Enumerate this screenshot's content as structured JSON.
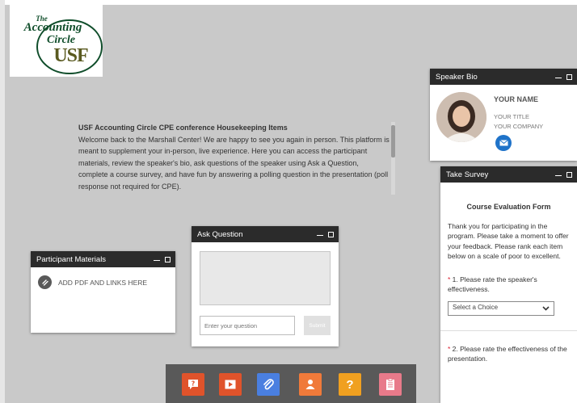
{
  "logo": {
    "line1": "The",
    "line2": "Accounting",
    "line3": "Circle",
    "line4": "USF"
  },
  "housekeeping": {
    "title": "USF Accounting Circle CPE conference Housekeeping Items",
    "body": "Welcome back to the Marshall Center! We are happy to see you again in person. This platform is meant to supplement your in-person, live experience. Here you can access the participant materials, review the speaker's bio, ask questions of the speaker using Ask a Question, complete a course survey, and have fun by answering a polling question in the presentation (poll response not required for CPE)."
  },
  "participant_materials": {
    "title": "Participant Materials",
    "item": "ADD PDF AND LINKS HERE"
  },
  "ask_question": {
    "title": "Ask Question",
    "input_placeholder": "Enter your question",
    "submit_label": "Submit"
  },
  "speaker_bio": {
    "title": "Speaker Bio",
    "name": "YOUR NAME",
    "job_title": "YOUR TITLE",
    "company": "YOUR COMPANY"
  },
  "take_survey": {
    "title": "Take Survey",
    "form_title": "Course Evaluation Form",
    "intro": "Thank you for participating in the program.  Please take a moment to offer your feedback.  Please rank each item below on a scale of poor to excellent.",
    "q1_star": "*",
    "q1": " 1. Please rate the speaker's effectiveness.",
    "select_value": "Select a Choice",
    "q2_star": "*",
    "q2": " 2. Please rate the effectiveness of the presentation."
  },
  "toolbar": {
    "buttons": [
      {
        "name": "ask-question-icon",
        "color": "#e0532b"
      },
      {
        "name": "video-icon",
        "color": "#e0532b"
      },
      {
        "name": "attachment-icon",
        "color": "#4a7fe0"
      },
      {
        "name": "speaker-icon",
        "color": "#f07a3a"
      },
      {
        "name": "help-icon",
        "color": "#f0a020"
      },
      {
        "name": "survey-icon",
        "color": "#e87a8a"
      }
    ],
    "help_glyph": "?"
  },
  "colors": {
    "widget_header": "#2b2b2b",
    "background": "#c9c9c9",
    "mail_button": "#1f73c9"
  }
}
